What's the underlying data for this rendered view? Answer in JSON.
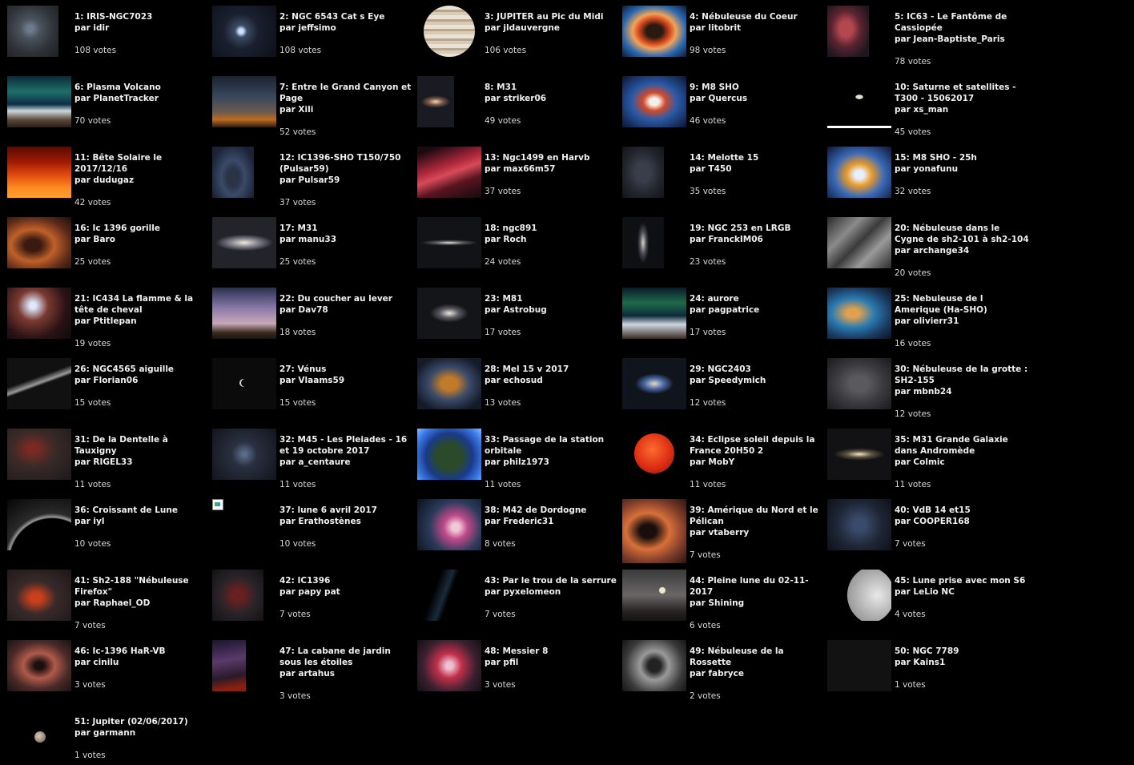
{
  "items": [
    {
      "title": "1: IRIS-NGC7023",
      "author": "par idir",
      "votes": "108 votes"
    },
    {
      "title": "2: NGC 6543 Cat s Eye",
      "author": "par jeffsimo",
      "votes": "108 votes"
    },
    {
      "title": "3: JUPITER au Pic du Midi",
      "author": "par jldauvergne",
      "votes": "106 votes"
    },
    {
      "title": "4: Nébuleuse du Coeur",
      "author": "par litobrit",
      "votes": "98 votes"
    },
    {
      "title": "5: IC63 - Le Fantôme de Cassiopée",
      "author": "par Jean-Baptiste_Paris",
      "votes": "78 votes"
    },
    {
      "title": "6: Plasma Volcano",
      "author": "par PlanetTracker",
      "votes": "70 votes"
    },
    {
      "title": "7: Entre le Grand Canyon et Page",
      "author": "par Xili",
      "votes": "52 votes"
    },
    {
      "title": "8: M31",
      "author": "par striker06",
      "votes": "49 votes"
    },
    {
      "title": "9: M8 SHO",
      "author": "par Quercus",
      "votes": "46 votes"
    },
    {
      "title": "10: Saturne et satellites - T300 - 15062017",
      "author": "par xs_man",
      "votes": "45 votes"
    },
    {
      "title": "11: Bête Solaire le 2017/12/16",
      "author": "par dudugaz",
      "votes": "42 votes"
    },
    {
      "title": "12: IC1396-SHO T150/750 (Pulsar59)",
      "author": "par Pulsar59",
      "votes": "37 votes"
    },
    {
      "title": "13: Ngc1499 en Harvb",
      "author": "par max66m57",
      "votes": "37 votes"
    },
    {
      "title": "14: Melotte 15",
      "author": "par T450",
      "votes": "35 votes"
    },
    {
      "title": "15: M8 SHO - 25h",
      "author": "par yonafunu",
      "votes": "32 votes"
    },
    {
      "title": "16: Ic 1396 gorille",
      "author": "par Baro",
      "votes": "25 votes"
    },
    {
      "title": "17: M31",
      "author": "par manu33",
      "votes": "25 votes"
    },
    {
      "title": "18: ngc891",
      "author": "par Roch",
      "votes": "24 votes"
    },
    {
      "title": "19: NGC 253 en LRGB",
      "author": "par FranckIM06",
      "votes": "23 votes"
    },
    {
      "title": "20: Nébuleuse dans le Cygne de sh2-101 à sh2-104",
      "author": "par archange34",
      "votes": "20 votes"
    },
    {
      "title": "21: IC434 La flamme & la tête de cheval",
      "author": "par Ptitlepan",
      "votes": "19 votes"
    },
    {
      "title": "22: Du coucher au lever",
      "author": "par Dav78",
      "votes": "18 votes"
    },
    {
      "title": "23: M81",
      "author": "par Astrobug",
      "votes": "17 votes"
    },
    {
      "title": "24: aurore",
      "author": "par pagpatrice",
      "votes": "17 votes"
    },
    {
      "title": "25: Nebuleuse de l Amerique (Ha-SHO)",
      "author": "par olivierr31",
      "votes": "16 votes"
    },
    {
      "title": "26: NGC4565 aiguille",
      "author": "par Florian06",
      "votes": "15 votes"
    },
    {
      "title": "27: Vénus",
      "author": "par Vlaams59",
      "votes": "15 votes"
    },
    {
      "title": "28: Mel 15 v 2017",
      "author": "par echosud",
      "votes": "13 votes"
    },
    {
      "title": "29: NGC2403",
      "author": "par Speedymich",
      "votes": "12 votes"
    },
    {
      "title": "30: Nébuleuse de la grotte : SH2-155",
      "author": "par mbnb24",
      "votes": "12 votes"
    },
    {
      "title": "31: De la Dentelle à Tauxigny",
      "author": "par RIGEL33",
      "votes": "11 votes"
    },
    {
      "title": "32: M45 - Les Pleiades - 16 et 19 octobre 2017",
      "author": "par a_centaure",
      "votes": "11 votes"
    },
    {
      "title": "33: Passage de la station orbitale",
      "author": "par philz1973",
      "votes": "11 votes"
    },
    {
      "title": "34: Eclipse soleil depuis la France 20H50 2",
      "author": "par MobY",
      "votes": "11 votes"
    },
    {
      "title": "35: M31 Grande Galaxie dans Andromède",
      "author": "par Colmic",
      "votes": "11 votes"
    },
    {
      "title": "36: Croissant de Lune",
      "author": "par iyl",
      "votes": "10 votes"
    },
    {
      "title": "37: lune 6 avril 2017",
      "author": "par Erathostènes",
      "votes": "10 votes"
    },
    {
      "title": "38: M42 de Dordogne",
      "author": "par Frederic31",
      "votes": "8 votes"
    },
    {
      "title": "39: Amérique du Nord et le Pélican",
      "author": "par vtaberry",
      "votes": "7 votes"
    },
    {
      "title": "40: VdB 14 et15",
      "author": "par COOPER168",
      "votes": "7 votes"
    },
    {
      "title": "41: Sh2-188 \"Nébuleuse Firefox\"",
      "author": "par Raphael_OD",
      "votes": "7 votes"
    },
    {
      "title": "42: IC1396",
      "author": "par papy pat",
      "votes": "7 votes"
    },
    {
      "title": "43: Par le trou de la serrure",
      "author": "par pyxelomeon",
      "votes": "7 votes"
    },
    {
      "title": "44: Pleine lune du 02-11-2017",
      "author": "par Shining",
      "votes": "6 votes"
    },
    {
      "title": "45: Lune prise avec mon S6",
      "author": "par LeLio NC",
      "votes": "4 votes"
    },
    {
      "title": "46: Ic-1396 HaR-VB",
      "author": "par cinilu",
      "votes": "3 votes"
    },
    {
      "title": "47: La cabane de jardin sous les étoiles",
      "author": "par artahus",
      "votes": "3 votes"
    },
    {
      "title": "48: Messier 8",
      "author": "par pfil",
      "votes": "3 votes"
    },
    {
      "title": "49: Nébuleuse de la Rossette",
      "author": "par fabryce",
      "votes": "2 votes"
    },
    {
      "title": "50: NGC 7789",
      "author": "par Kains1",
      "votes": "1 votes"
    },
    {
      "title": "51: Jupiter (02/06/2017)",
      "author": "par garmann",
      "votes": "1 votes"
    }
  ]
}
